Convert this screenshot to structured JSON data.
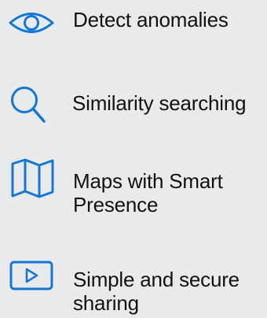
{
  "accent_color": "#1477d4",
  "features": [
    {
      "icon": "eye-icon",
      "label": "Detect anomalies"
    },
    {
      "icon": "search-icon",
      "label": "Similarity searching"
    },
    {
      "icon": "map-icon",
      "label": "Maps with Smart\nPresence"
    },
    {
      "icon": "play-icon",
      "label": "Simple and secure\nsharing"
    }
  ]
}
